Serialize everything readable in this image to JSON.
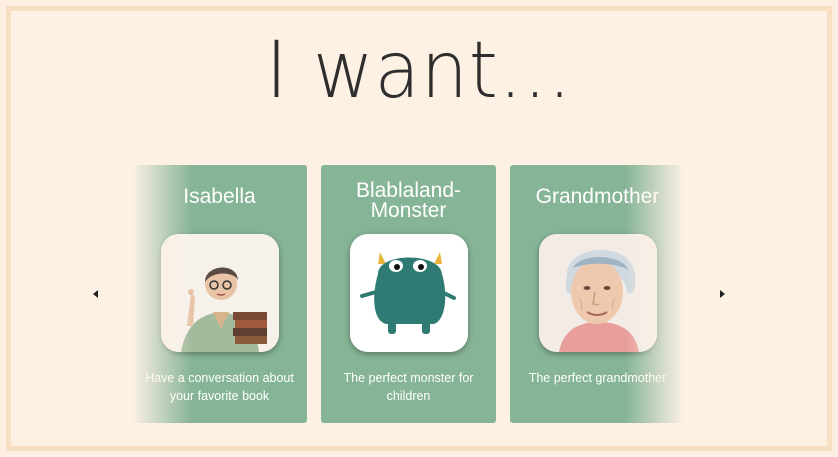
{
  "page": {
    "title": "I want..."
  },
  "carousel": {
    "prev_icon": "chevron-left-icon",
    "next_icon": "chevron-right-icon",
    "cards": [
      {
        "name": "Isabella",
        "description": "Have a conversation about your favorite book"
      },
      {
        "name": "Blablaland-Monster",
        "description": "The perfect monster for children"
      },
      {
        "name": "Grandmother",
        "description": "The perfect grandmother"
      }
    ]
  },
  "colors": {
    "background": "#fdf1e4",
    "border": "#f8dfc4",
    "card": "#86b496",
    "monster": "#2f7b74"
  }
}
